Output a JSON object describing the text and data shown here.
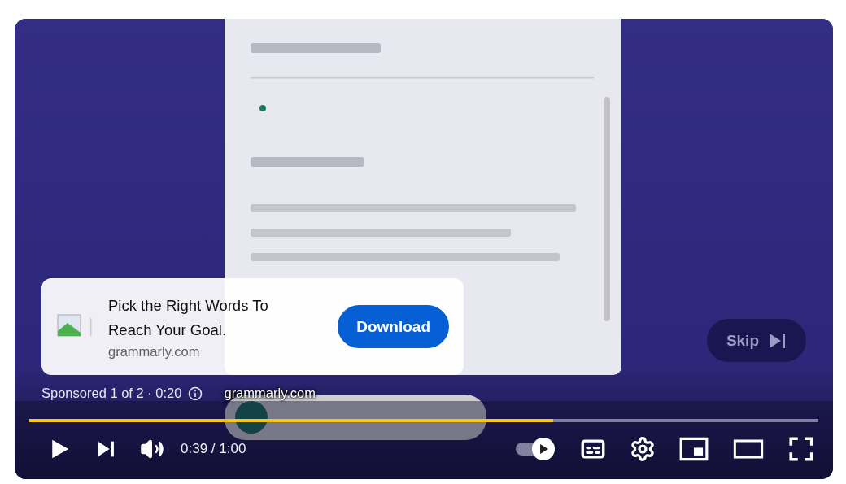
{
  "player": {
    "ad": {
      "title": "Pick the Right Words To Reach Your Goal.",
      "domain": "grammarly.com",
      "button": "Download",
      "sponsored": "Sponsored 1 of 2 · 0:20",
      "link": "grammarly.com"
    },
    "skip": "Skip",
    "progress": {
      "level": 0.664
    },
    "controls": {
      "time": "0:39 / 1:00",
      "autoplay": {
        "on": true
      }
    }
  }
}
